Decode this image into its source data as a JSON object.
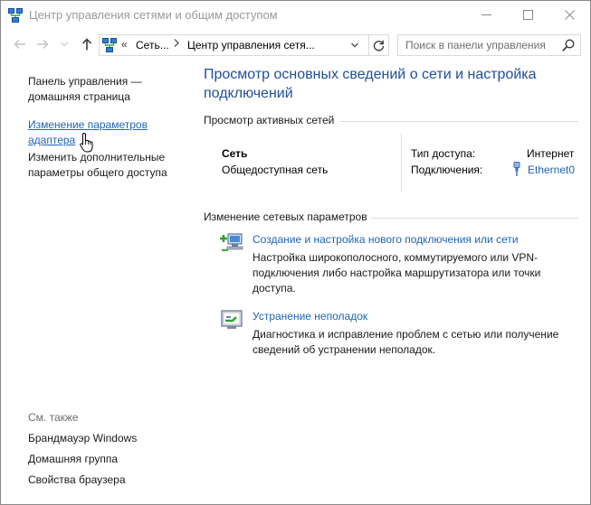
{
  "window": {
    "title": "Центр управления сетями и общим доступом",
    "controls": {
      "minimize_icon": "minimize-icon",
      "maximize_icon": "maximize-icon",
      "close_icon": "close-icon"
    }
  },
  "navigation": {
    "back_icon": "arrow-left-icon",
    "forward_icon": "arrow-right-icon",
    "recent_icon": "chevron-down-icon",
    "up_icon": "arrow-up-icon",
    "address": {
      "overflow": "«",
      "segments": [
        "Сеть...",
        "Центр управления сетя..."
      ]
    },
    "refresh_icon": "refresh-icon",
    "search_placeholder": "Поиск в панели управления"
  },
  "sidebar": {
    "items": [
      {
        "label": "Панель управления —\nдомашняя страница"
      },
      {
        "label": "Изменение параметров\nадаптера"
      },
      {
        "label": "Изменить дополнительные\nпараметры общего доступа"
      }
    ],
    "see_also_title": "См. также",
    "see_also": [
      "Брандмауэр Windows",
      "Домашняя группа",
      "Свойства браузера"
    ]
  },
  "main": {
    "heading": "Просмотр основных сведений о сети и настройка подключений",
    "active_networks_title": "Просмотр активных сетей",
    "network": {
      "name": "Сеть",
      "type": "Общедоступная сеть",
      "access_label": "Тип доступа:",
      "access_value": "Интернет",
      "connections_label": "Подключения:",
      "connection": "Ethernet0"
    },
    "change_settings_title": "Изменение сетевых параметров",
    "tasks": [
      {
        "icon": "new-connection-icon",
        "link": "Создание и настройка нового подключения или сети",
        "description": "Настройка широкополосного, коммутируемого или VPN-подключения либо настройка маршрутизатора или точки доступа."
      },
      {
        "icon": "troubleshoot-icon",
        "link": "Устранение неполадок",
        "description": "Диагностика и исправление проблем с сетью или получение сведений об устранении неполадок."
      }
    ]
  }
}
